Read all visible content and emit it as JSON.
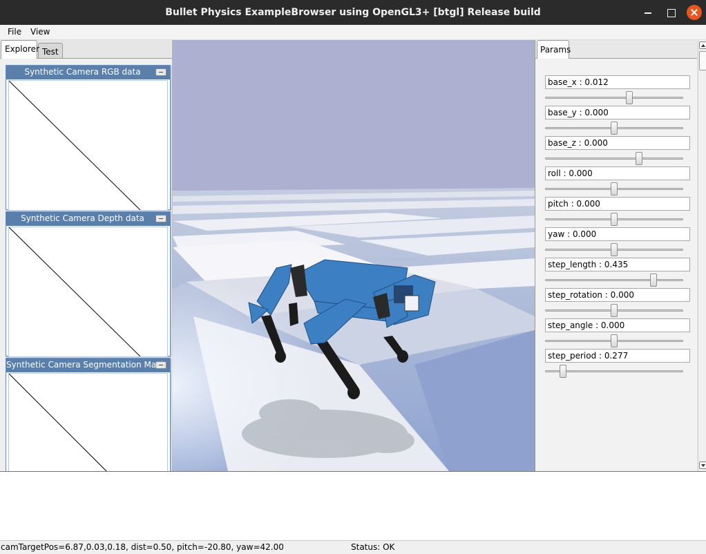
{
  "window": {
    "title": "Bullet Physics ExampleBrowser using OpenGL3+ [btgl] Release build"
  },
  "menubar": {
    "items": [
      {
        "label": "File"
      },
      {
        "label": "View"
      }
    ]
  },
  "left_panel": {
    "tabs": [
      {
        "label": "Explorer",
        "active": true
      },
      {
        "label": "Test",
        "active": false
      }
    ],
    "camera_windows": [
      {
        "title": "Synthetic Camera RGB data"
      },
      {
        "title": "Synthetic Camera Depth data"
      },
      {
        "title": "Synthetic Camera Segmentation Mask"
      }
    ]
  },
  "right_panel": {
    "tab_label": "Params",
    "params": [
      {
        "label": "base_x : 0.012",
        "level": 0.61
      },
      {
        "label": "base_y : 0.000",
        "level": 0.5
      },
      {
        "label": "base_z : 0.000",
        "level": 0.68
      },
      {
        "label": "roll : 0.000",
        "level": 0.5
      },
      {
        "label": "pitch : 0.000",
        "level": 0.5
      },
      {
        "label": "yaw : 0.000",
        "level": 0.5
      },
      {
        "label": "step_length : 0.435",
        "level": 0.79
      },
      {
        "label": "step_rotation : 0.000",
        "level": 0.5
      },
      {
        "label": "step_angle : 0.000",
        "level": 0.5
      },
      {
        "label": "step_period : 0.277",
        "level": 0.125
      }
    ]
  },
  "statusbar": {
    "camera": "camTargetPos=6.87,0.03,0.18, dist=0.50, pitch=-20.80, yaw=42.00",
    "status": "Status: OK"
  },
  "colors": {
    "titlebar": "#2b2b2b",
    "close_button": "#e95420",
    "sky": "#aeb0d1",
    "robot": "#3d7fc3",
    "camera_header": "#5b7fab"
  }
}
